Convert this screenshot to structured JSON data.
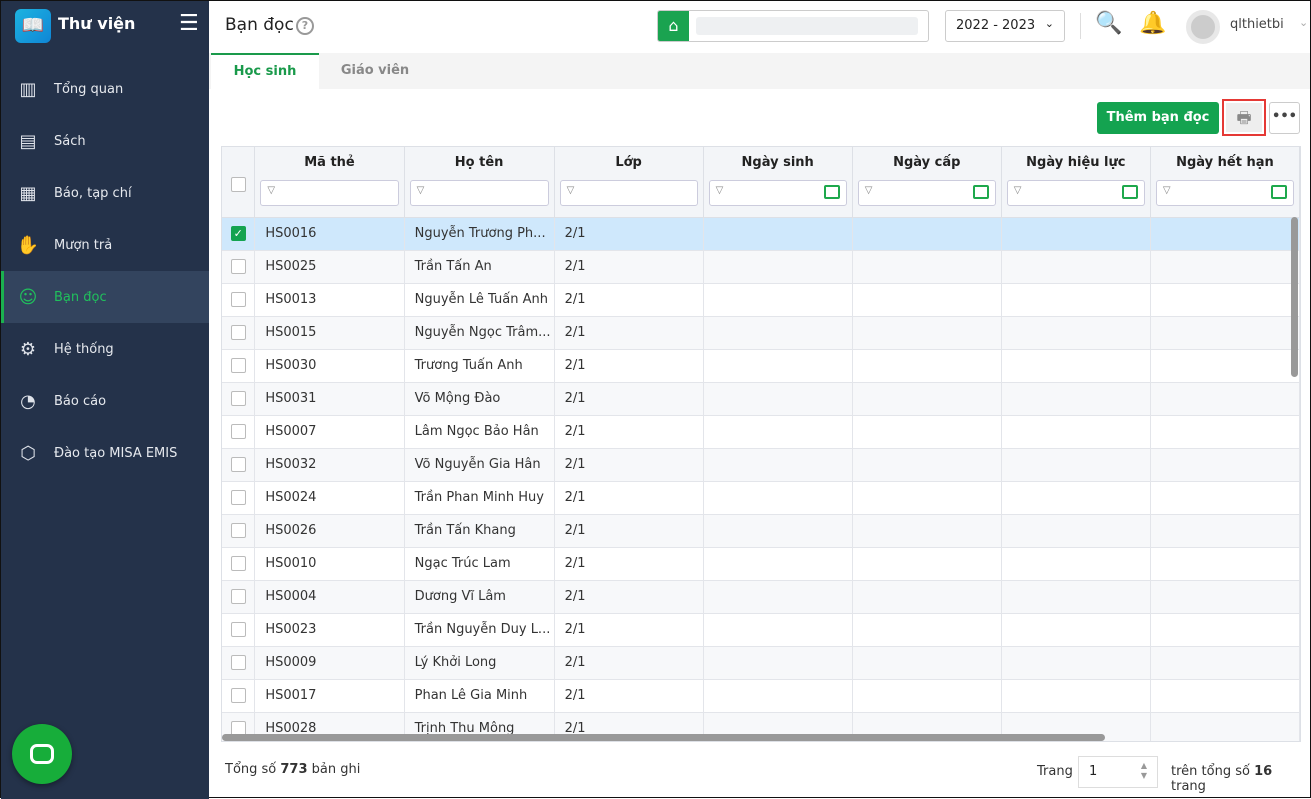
{
  "app": {
    "name": "Thư viện"
  },
  "sidebar": {
    "items": [
      {
        "label": "Tổng quan",
        "icon": "chart-icon",
        "glyph": "▥"
      },
      {
        "label": "Sách",
        "icon": "book-icon",
        "glyph": "▤"
      },
      {
        "label": "Báo, tạp chí",
        "icon": "newspaper-icon",
        "glyph": "▦"
      },
      {
        "label": "Mượn trả",
        "icon": "borrow-icon",
        "glyph": "✋"
      },
      {
        "label": "Bạn đọc",
        "icon": "reader-icon",
        "glyph": "☺",
        "active": true
      },
      {
        "label": "Hệ thống",
        "icon": "gear-icon",
        "glyph": "⚙"
      },
      {
        "label": "Báo cáo",
        "icon": "pie-chart-icon",
        "glyph": "◔"
      },
      {
        "label": "Đào tạo MISA EMIS",
        "icon": "cube-icon",
        "glyph": "⬡"
      }
    ]
  },
  "header": {
    "title": "Bạn đọc",
    "help": "?",
    "year": "2022 - 2023",
    "username": "qlthietbi"
  },
  "tabs": [
    "Học sinh",
    "Giáo viên"
  ],
  "toolbar": {
    "add_label": "Thêm bạn đọc",
    "more": "•••"
  },
  "table": {
    "columns": [
      "Mã thẻ",
      "Họ tên",
      "Lớp",
      "Ngày sinh",
      "Ngày cấp",
      "Ngày hiệu lực",
      "Ngày hết hạn"
    ],
    "rows": [
      [
        "HS0016",
        "Nguyễn Trương Ph...",
        "2/1"
      ],
      [
        "HS0025",
        "Trần Tấn An",
        "2/1"
      ],
      [
        "HS0013",
        "Nguyễn Lê Tuấn Anh",
        "2/1"
      ],
      [
        "HS0015",
        "Nguyễn Ngọc Trâm...",
        "2/1"
      ],
      [
        "HS0030",
        "Trương Tuấn Anh",
        "2/1"
      ],
      [
        "HS0031",
        "Võ Mộng Đào",
        "2/1"
      ],
      [
        "HS0007",
        "Lâm Ngọc Bảo Hân",
        "2/1"
      ],
      [
        "HS0032",
        "Võ Nguyễn Gia Hân",
        "2/1"
      ],
      [
        "HS0024",
        "Trần Phan Minh Huy",
        "2/1"
      ],
      [
        "HS0026",
        "Trần Tấn Khang",
        "2/1"
      ],
      [
        "HS0010",
        "Ngạc Trúc Lam",
        "2/1"
      ],
      [
        "HS0004",
        "Dương Vĩ Lâm",
        "2/1"
      ],
      [
        "HS0023",
        "Trần Nguyễn Duy L...",
        "2/1"
      ],
      [
        "HS0009",
        "Lý Khởi Long",
        "2/1"
      ],
      [
        "HS0017",
        "Phan Lê Gia Minh",
        "2/1"
      ],
      [
        "HS0028",
        "Trịnh Thu Mông",
        "2/1"
      ]
    ],
    "selected_row": 0
  },
  "footer": {
    "total_prefix": "Tổng số ",
    "total": "773",
    "total_suffix": " bản ghi",
    "page_label": "Trang",
    "page": "1",
    "pages_prefix": "trên tổng số ",
    "pages": "16",
    "pages_suffix": " trang"
  }
}
